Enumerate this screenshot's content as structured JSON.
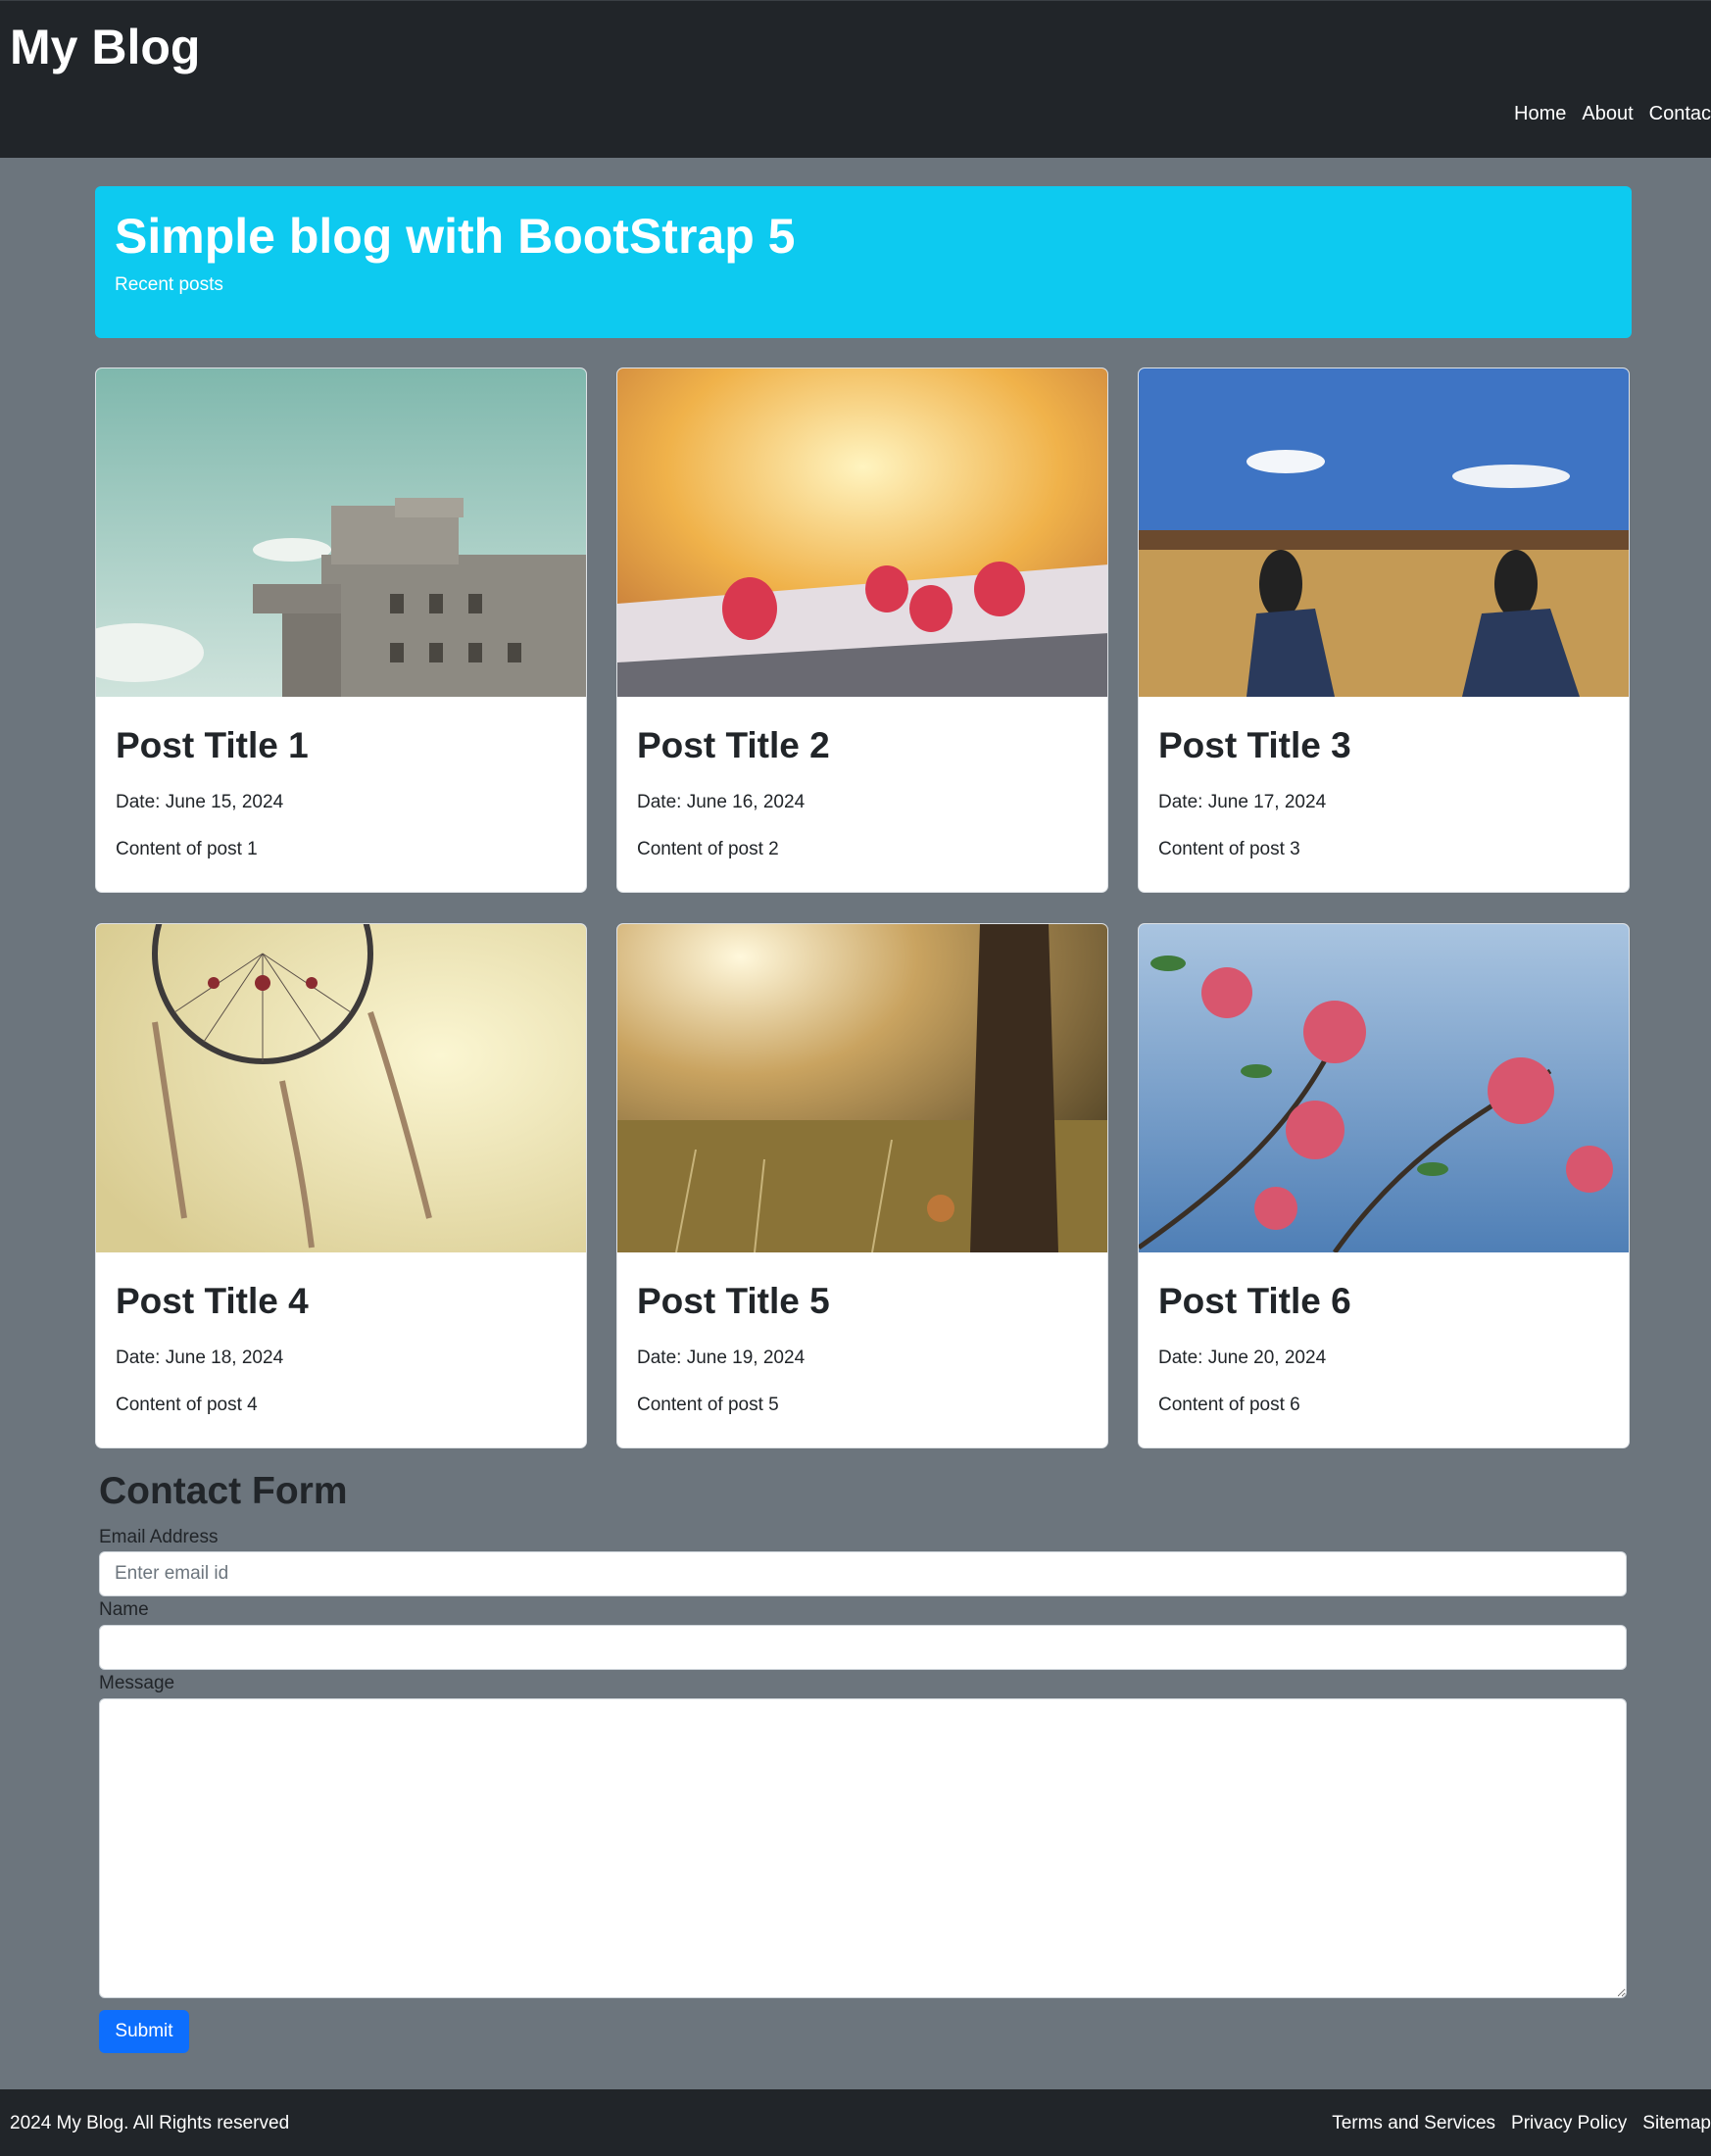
{
  "navbar": {
    "brand": "My Blog",
    "links": [
      "Home",
      "About",
      "Contac"
    ]
  },
  "hero": {
    "title": "Simple blog with BootStrap 5",
    "subtitle": "Recent posts"
  },
  "posts": [
    {
      "title": "Post Title 1",
      "date": "Date: June 15, 2024",
      "content": "Content of post 1",
      "image_icon": "building-photo"
    },
    {
      "title": "Post Title 2",
      "date": "Date: June 16, 2024",
      "content": "Content of post 2",
      "image_icon": "raspberries-photo"
    },
    {
      "title": "Post Title 3",
      "date": "Date: June 17, 2024",
      "content": "Content of post 3",
      "image_icon": "field-sneakers-photo"
    },
    {
      "title": "Post Title 4",
      "date": "Date: June 18, 2024",
      "content": "Content of post 4",
      "image_icon": "dreamcatcher-photo"
    },
    {
      "title": "Post Title 5",
      "date": "Date: June 19, 2024",
      "content": "Content of post 5",
      "image_icon": "sunlit-meadow-photo"
    },
    {
      "title": "Post Title 6",
      "date": "Date: June 20, 2024",
      "content": "Content of post 6",
      "image_icon": "pink-blossoms-photo"
    }
  ],
  "contact": {
    "title": "Contact Form",
    "email_label": "Email Address",
    "email_placeholder": "Enter email id",
    "email_value": "",
    "name_label": "Name",
    "name_value": "",
    "message_label": "Message",
    "message_value": "",
    "submit_label": "Submit"
  },
  "footer": {
    "copyright": "2024 My Blog. All Rights reserved",
    "links": [
      "Terms and Services",
      "Privacy Policy",
      "Sitemap"
    ]
  },
  "colors": {
    "navbar_bg": "#212529",
    "page_bg": "#6c757d",
    "hero_bg": "#0dcaf0",
    "submit_bg": "#0d6efd"
  }
}
